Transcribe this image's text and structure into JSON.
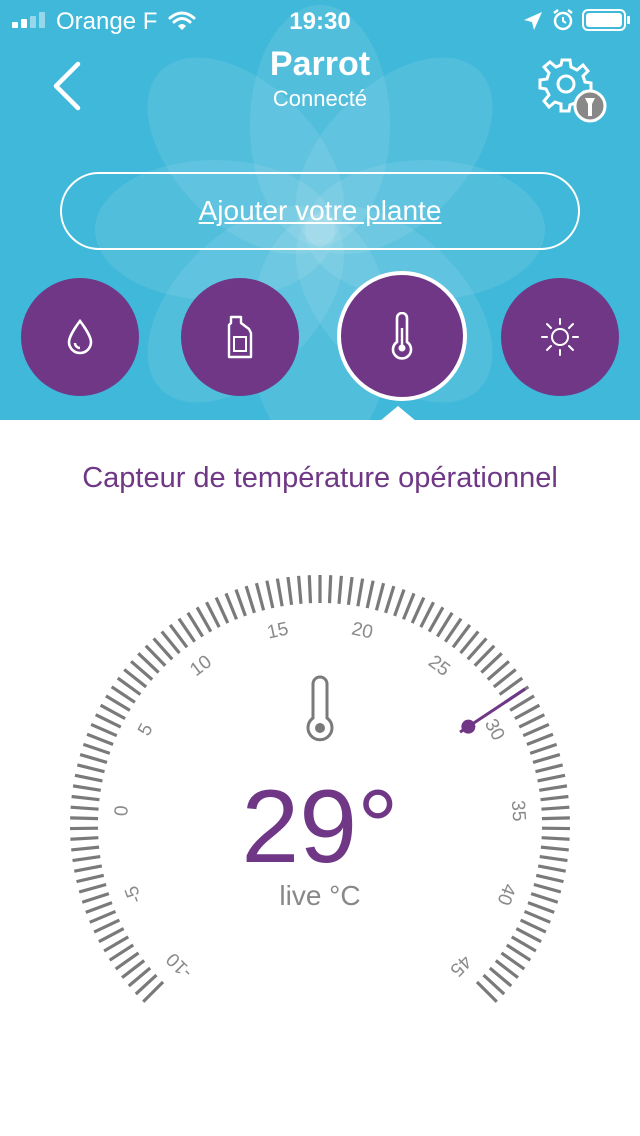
{
  "status_bar": {
    "carrier": "Orange F",
    "time": "19:30"
  },
  "nav": {
    "title": "Parrot",
    "subtitle": "Connecté"
  },
  "add_plant_label": "Ajouter votre plante",
  "sensor_tabs": [
    {
      "name": "water-drop-icon"
    },
    {
      "name": "fertilizer-bottle-icon"
    },
    {
      "name": "thermometer-icon",
      "active": true
    },
    {
      "name": "sun-icon"
    }
  ],
  "sensor_status": "Capteur de température opérationnel",
  "gauge": {
    "current_value": 29,
    "display_value": "29°",
    "unit_label": "live °C",
    "min": -10,
    "max": 45,
    "tick_labels": [
      "-10",
      "-5",
      "0",
      "5",
      "10",
      "15",
      "20",
      "25",
      "30",
      "35",
      "40",
      "45"
    ]
  },
  "colors": {
    "header": "#40b8d9",
    "accent": "#6f3786",
    "tick": "#7a7a7a"
  }
}
